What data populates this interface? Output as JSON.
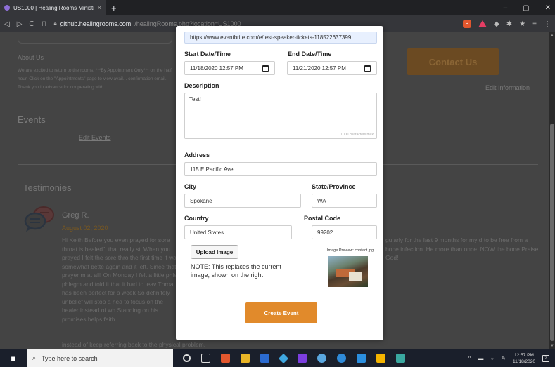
{
  "browser": {
    "tab_title": "US1000 | Healing Rooms Ministrie",
    "tab_close": "×",
    "new_tab": "+",
    "url_domain": "github.healingrooms.com",
    "url_path": "/healingRooms.php?location=US1000",
    "controls": {
      "minimize": "–",
      "maximize": "▢",
      "close": "✕"
    }
  },
  "background_page": {
    "about_title": "About Us",
    "about_body": "We are excited to return to the rooms. ***By Appointment Only*** on the half hour. Click on the \"Appointments\" page to view avail... confirmation email. Thank you in advance for cooperating with...",
    "contact_button": "Contact Us",
    "edit_information": "Edit Information",
    "events_title": "Events",
    "edit_events": "Edit Events",
    "testimonies_title": "Testimonies",
    "testimonial": {
      "author": "Greg R.",
      "date": "August 02, 2020",
      "body_left": "Hi Keith Before you even prayed for sore throat is healed\"..that really sti When you prayed I felt the sore thro the first time it was somewhat bette again and it left. Since that prayer m at all! On Monday I felt a little phleg phlegm and told it that it had to leav Throat has been perfect for a week So definitely unbelief will stop a hea to focus on the healer instead of wh Standing on his promises helps faith",
      "body_right": "gularly for the last 9 months for my d to be free from a bone infection. He more than once. NOW the bone Praise God!",
      "body_bottom": "instead of keep referring back to the physical problem."
    }
  },
  "modal": {
    "url_value": "https://www.eventbrite.com/e/test-speaker-tickets-118522637399",
    "start_label": "Start Date/Time",
    "start_value": "11/18/2020 12:57 PM",
    "end_label": "End Date/Time",
    "end_value": "11/21/2020 12:57 PM",
    "description_label": "Description",
    "description_value": "Test!",
    "char_max": "1000 characters max",
    "address_label": "Address",
    "address_value": "115 E Pacific Ave",
    "city_label": "City",
    "city_value": "Spokane",
    "state_label": "State/Province",
    "state_value": "WA",
    "country_label": "Country",
    "country_value": "United States",
    "postal_label": "Postal Code",
    "postal_value": "99202",
    "upload_button": "Upload Image",
    "upload_note": "NOTE: This replaces the current image, shown on the right",
    "preview_label": "Image Preview: contact.jpg",
    "create_button": "Create Event"
  },
  "taskbar": {
    "search_placeholder": "Type here to search",
    "time": "12:57 PM",
    "date": "11/18/2020",
    "notification_count": "2"
  }
}
